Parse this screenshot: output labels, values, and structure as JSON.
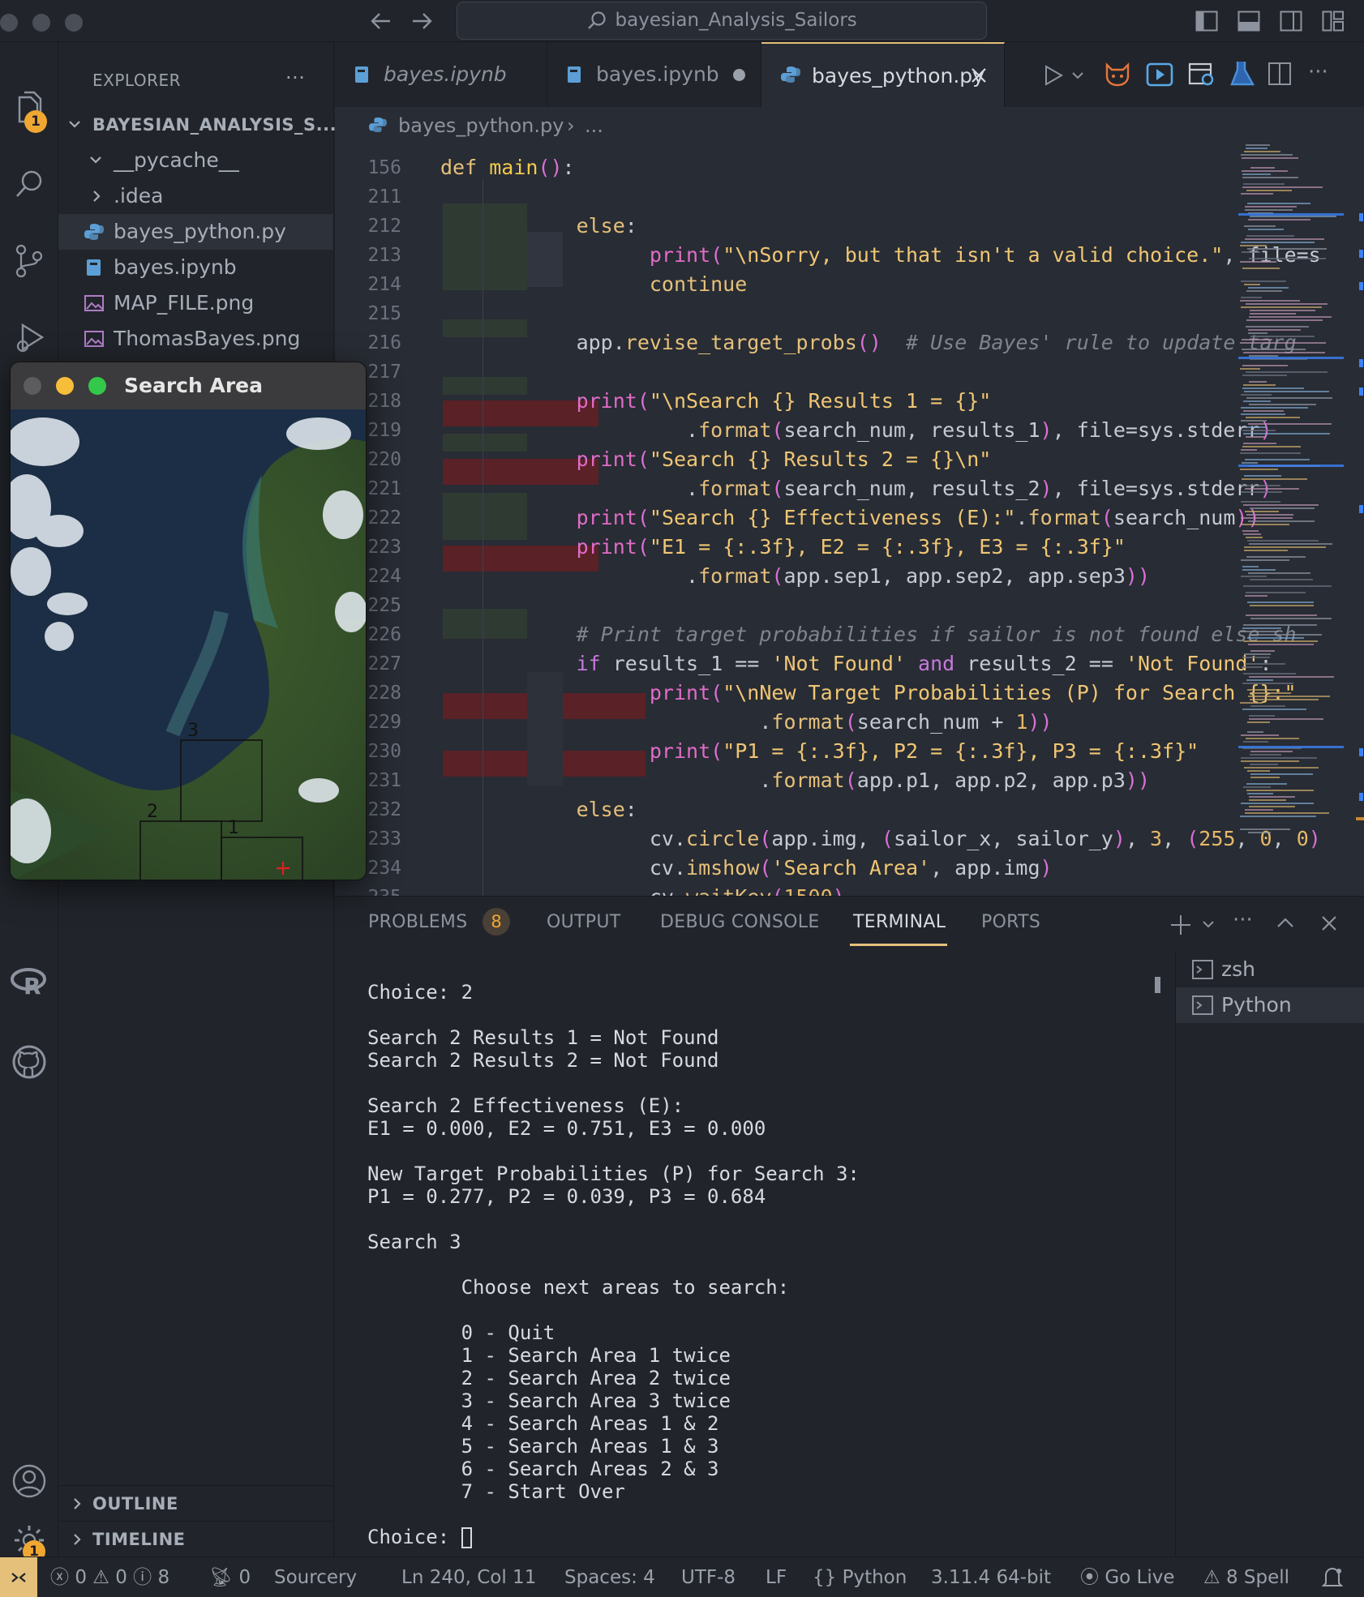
{
  "titlebar": {
    "search_text": "bayesian_Analysis_Sailors"
  },
  "activity": {
    "explorer_badge": "1",
    "settings_badge": "1"
  },
  "sidebar": {
    "title": "EXPLORER",
    "more": "···",
    "root": "BAYESIAN_ANALYSIS_S...",
    "items": [
      {
        "label": "__pycache__",
        "type": "folder-open"
      },
      {
        "label": ".idea",
        "type": "folder"
      },
      {
        "label": "bayes_python.py",
        "type": "python"
      },
      {
        "label": "bayes.ipynb",
        "type": "notebook"
      },
      {
        "label": "MAP_FILE.png",
        "type": "image"
      },
      {
        "label": "ThomasBayes.png",
        "type": "image"
      }
    ],
    "outline": "OUTLINE",
    "timeline": "TIMELINE"
  },
  "tabs": [
    {
      "label": "bayes.ipynb",
      "italic": true
    },
    {
      "label": "bayes.ipynb",
      "modified": true
    },
    {
      "label": "bayes_python.py",
      "active": true
    }
  ],
  "breadcrumb": {
    "file": "bayes_python.py",
    "rest": "..."
  },
  "editor": {
    "line_numbers": [
      "156",
      "211",
      "212",
      "213",
      "214",
      "215",
      "216",
      "217",
      "218",
      "219",
      "220",
      "221",
      "222",
      "223",
      "224",
      "225",
      "226",
      "227",
      "228",
      "229",
      "230",
      "231",
      "232",
      "233",
      "234",
      "235"
    ]
  },
  "search_window": {
    "title": "Search Area",
    "area_labels": [
      "3",
      "2",
      "1"
    ]
  },
  "panel": {
    "tabs": [
      "PROBLEMS",
      "OUTPUT",
      "DEBUG CONSOLE",
      "TERMINAL",
      "PORTS"
    ],
    "problems_count": "8",
    "terminal_lines": [
      "Choice: 2",
      "",
      "Search 2 Results 1 = Not Found",
      "Search 2 Results 2 = Not Found",
      "",
      "Search 2 Effectiveness (E):",
      "E1 = 0.000, E2 = 0.751, E3 = 0.000",
      "",
      "New Target Probabilities (P) for Search 3:",
      "P1 = 0.277, P2 = 0.039, P3 = 0.684",
      "",
      "Search 3",
      "",
      "        Choose next areas to search:",
      "",
      "        0 - Quit",
      "        1 - Search Area 1 twice",
      "        2 - Search Area 2 twice",
      "        3 - Search Area 3 twice",
      "        4 - Search Areas 1 & 2",
      "        5 - Search Areas 1 & 3",
      "        6 - Search Areas 2 & 3",
      "        7 - Start Over",
      "",
      "Choice: "
    ],
    "terminals": [
      "zsh",
      "Python"
    ]
  },
  "statusbar": {
    "errors": "0",
    "warnings": "0",
    "infos": "8",
    "ports": "0",
    "sourcery": "Sourcery",
    "position": "Ln 240, Col 11",
    "spaces": "Spaces: 4",
    "encoding": "UTF-8",
    "eol": "LF",
    "language": "Python",
    "interpreter": "3.11.4 64-bit",
    "golive": "Go Live",
    "spell": "8 Spell"
  }
}
